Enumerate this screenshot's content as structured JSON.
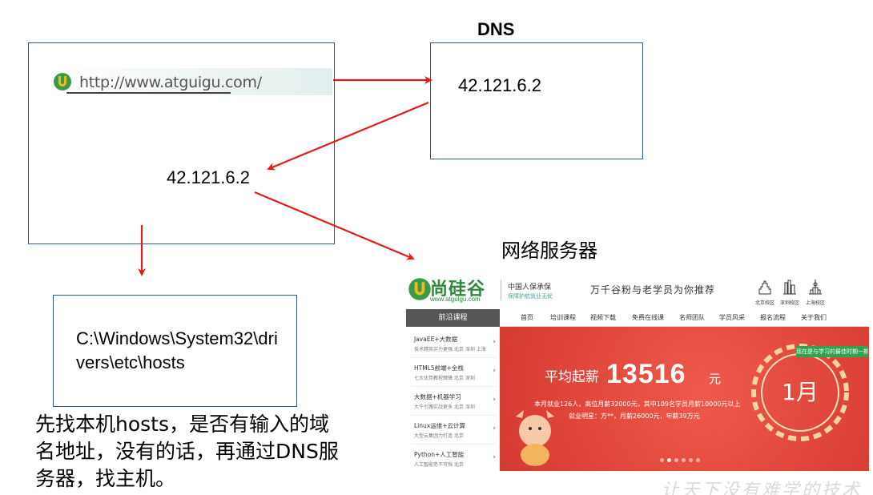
{
  "dns_title": "DNS",
  "dns_ip": "42.121.6.2",
  "browser": {
    "url": "http://www.atguigu.com/",
    "resolved_ip": "42.121.6.2"
  },
  "hosts_path": "C:\\Windows\\System32\\drivers\\etc\\hosts",
  "web_server_label": "网络服务器",
  "note": "先找本机hosts，是否有输入的域名地址，没有的话，再通过DNS服务器，找主机。",
  "arrow_color": "#e31b1b",
  "box_border_color": "#2e5b8c",
  "website": {
    "brand": "尚硅谷",
    "domain": "www.atguigu.com",
    "insurance": "中国人保承保",
    "insurance_sub": "保障护航就业无忧",
    "slogan": "万千谷粉与老学员为你推荐",
    "campuses": [
      "北京校区",
      "深圳校区",
      "上海校区"
    ],
    "sidebar_title": "前沿课程",
    "nav": [
      "首页",
      "培训课程",
      "视频下载",
      "免费在线课",
      "名师团队",
      "学员风采",
      "报名流程",
      "关于我们"
    ],
    "courses": [
      {
        "title": "JavaEE+大数据",
        "sub": "技术精英实力更强  北京 深圳 上海"
      },
      {
        "title": "HTML5前端+全栈",
        "sub": "七大优势教程肆锋  北京 深圳"
      },
      {
        "title": "大数据+机器学习",
        "sub": "大牛引路实战更多  北京 深圳"
      },
      {
        "title": "Linux运维+云计算",
        "sub": "大型云集团力打造  北京"
      },
      {
        "title": "Python+人工智能",
        "sub": "人工智能势不可挡  北京"
      }
    ],
    "banner": {
      "avg_label": "平均起薪",
      "salary": "13516",
      "unit": "元",
      "line1": "本月就业126人，高位月薪32000元，其中109名学员月薪10000元以上",
      "line2": "就业明星：方**，月薪26000元，年薪39万元",
      "badge": "现在是与学习的最佳时期一期",
      "month": "1月",
      "active_dot": 1,
      "dot_count": 6
    }
  },
  "watermark": "让天下没有难学的技术"
}
